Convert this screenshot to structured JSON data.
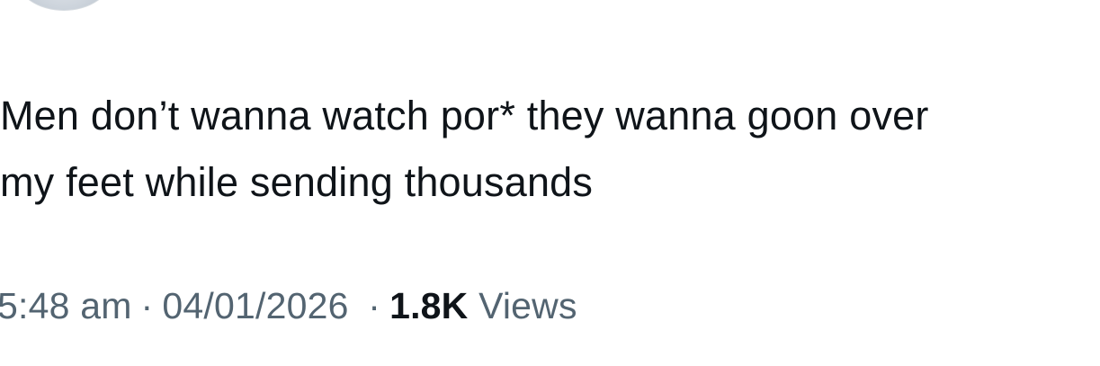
{
  "post": {
    "text_lines": [
      "Men don’t wanna watch por* they wanna goon over",
      "my feet while sending thousands"
    ],
    "time": "5:48 am",
    "date": "04/01/2026",
    "separator": "·",
    "views_count": "1.8K",
    "views_label": "Views"
  }
}
